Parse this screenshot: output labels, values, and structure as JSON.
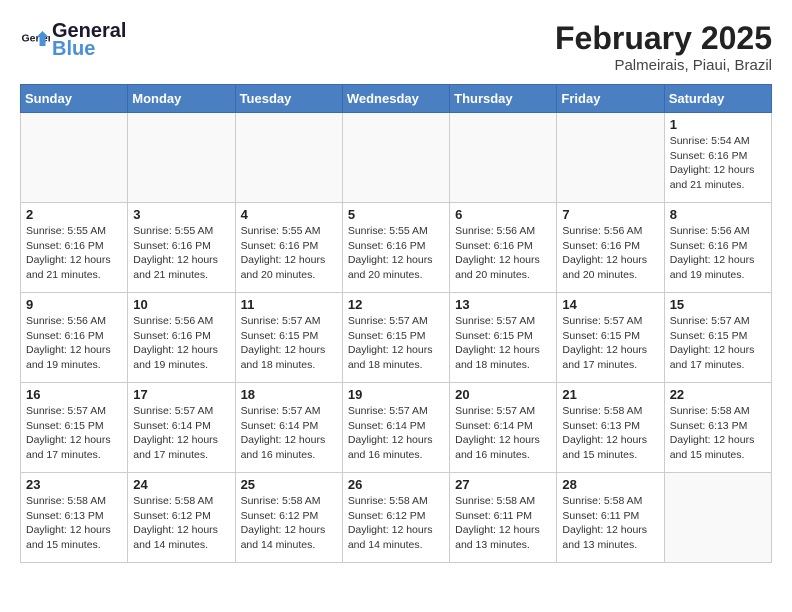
{
  "header": {
    "logo_general": "General",
    "logo_blue": "Blue",
    "month_year": "February 2025",
    "location": "Palmeirais, Piaui, Brazil"
  },
  "days_of_week": [
    "Sunday",
    "Monday",
    "Tuesday",
    "Wednesday",
    "Thursday",
    "Friday",
    "Saturday"
  ],
  "weeks": [
    [
      {
        "day": "",
        "info": ""
      },
      {
        "day": "",
        "info": ""
      },
      {
        "day": "",
        "info": ""
      },
      {
        "day": "",
        "info": ""
      },
      {
        "day": "",
        "info": ""
      },
      {
        "day": "",
        "info": ""
      },
      {
        "day": "1",
        "info": "Sunrise: 5:54 AM\nSunset: 6:16 PM\nDaylight: 12 hours\nand 21 minutes."
      }
    ],
    [
      {
        "day": "2",
        "info": "Sunrise: 5:55 AM\nSunset: 6:16 PM\nDaylight: 12 hours\nand 21 minutes."
      },
      {
        "day": "3",
        "info": "Sunrise: 5:55 AM\nSunset: 6:16 PM\nDaylight: 12 hours\nand 21 minutes."
      },
      {
        "day": "4",
        "info": "Sunrise: 5:55 AM\nSunset: 6:16 PM\nDaylight: 12 hours\nand 20 minutes."
      },
      {
        "day": "5",
        "info": "Sunrise: 5:55 AM\nSunset: 6:16 PM\nDaylight: 12 hours\nand 20 minutes."
      },
      {
        "day": "6",
        "info": "Sunrise: 5:56 AM\nSunset: 6:16 PM\nDaylight: 12 hours\nand 20 minutes."
      },
      {
        "day": "7",
        "info": "Sunrise: 5:56 AM\nSunset: 6:16 PM\nDaylight: 12 hours\nand 20 minutes."
      },
      {
        "day": "8",
        "info": "Sunrise: 5:56 AM\nSunset: 6:16 PM\nDaylight: 12 hours\nand 19 minutes."
      }
    ],
    [
      {
        "day": "9",
        "info": "Sunrise: 5:56 AM\nSunset: 6:16 PM\nDaylight: 12 hours\nand 19 minutes."
      },
      {
        "day": "10",
        "info": "Sunrise: 5:56 AM\nSunset: 6:16 PM\nDaylight: 12 hours\nand 19 minutes."
      },
      {
        "day": "11",
        "info": "Sunrise: 5:57 AM\nSunset: 6:15 PM\nDaylight: 12 hours\nand 18 minutes."
      },
      {
        "day": "12",
        "info": "Sunrise: 5:57 AM\nSunset: 6:15 PM\nDaylight: 12 hours\nand 18 minutes."
      },
      {
        "day": "13",
        "info": "Sunrise: 5:57 AM\nSunset: 6:15 PM\nDaylight: 12 hours\nand 18 minutes."
      },
      {
        "day": "14",
        "info": "Sunrise: 5:57 AM\nSunset: 6:15 PM\nDaylight: 12 hours\nand 17 minutes."
      },
      {
        "day": "15",
        "info": "Sunrise: 5:57 AM\nSunset: 6:15 PM\nDaylight: 12 hours\nand 17 minutes."
      }
    ],
    [
      {
        "day": "16",
        "info": "Sunrise: 5:57 AM\nSunset: 6:15 PM\nDaylight: 12 hours\nand 17 minutes."
      },
      {
        "day": "17",
        "info": "Sunrise: 5:57 AM\nSunset: 6:14 PM\nDaylight: 12 hours\nand 17 minutes."
      },
      {
        "day": "18",
        "info": "Sunrise: 5:57 AM\nSunset: 6:14 PM\nDaylight: 12 hours\nand 16 minutes."
      },
      {
        "day": "19",
        "info": "Sunrise: 5:57 AM\nSunset: 6:14 PM\nDaylight: 12 hours\nand 16 minutes."
      },
      {
        "day": "20",
        "info": "Sunrise: 5:57 AM\nSunset: 6:14 PM\nDaylight: 12 hours\nand 16 minutes."
      },
      {
        "day": "21",
        "info": "Sunrise: 5:58 AM\nSunset: 6:13 PM\nDaylight: 12 hours\nand 15 minutes."
      },
      {
        "day": "22",
        "info": "Sunrise: 5:58 AM\nSunset: 6:13 PM\nDaylight: 12 hours\nand 15 minutes."
      }
    ],
    [
      {
        "day": "23",
        "info": "Sunrise: 5:58 AM\nSunset: 6:13 PM\nDaylight: 12 hours\nand 15 minutes."
      },
      {
        "day": "24",
        "info": "Sunrise: 5:58 AM\nSunset: 6:12 PM\nDaylight: 12 hours\nand 14 minutes."
      },
      {
        "day": "25",
        "info": "Sunrise: 5:58 AM\nSunset: 6:12 PM\nDaylight: 12 hours\nand 14 minutes."
      },
      {
        "day": "26",
        "info": "Sunrise: 5:58 AM\nSunset: 6:12 PM\nDaylight: 12 hours\nand 14 minutes."
      },
      {
        "day": "27",
        "info": "Sunrise: 5:58 AM\nSunset: 6:11 PM\nDaylight: 12 hours\nand 13 minutes."
      },
      {
        "day": "28",
        "info": "Sunrise: 5:58 AM\nSunset: 6:11 PM\nDaylight: 12 hours\nand 13 minutes."
      },
      {
        "day": "",
        "info": ""
      }
    ]
  ]
}
